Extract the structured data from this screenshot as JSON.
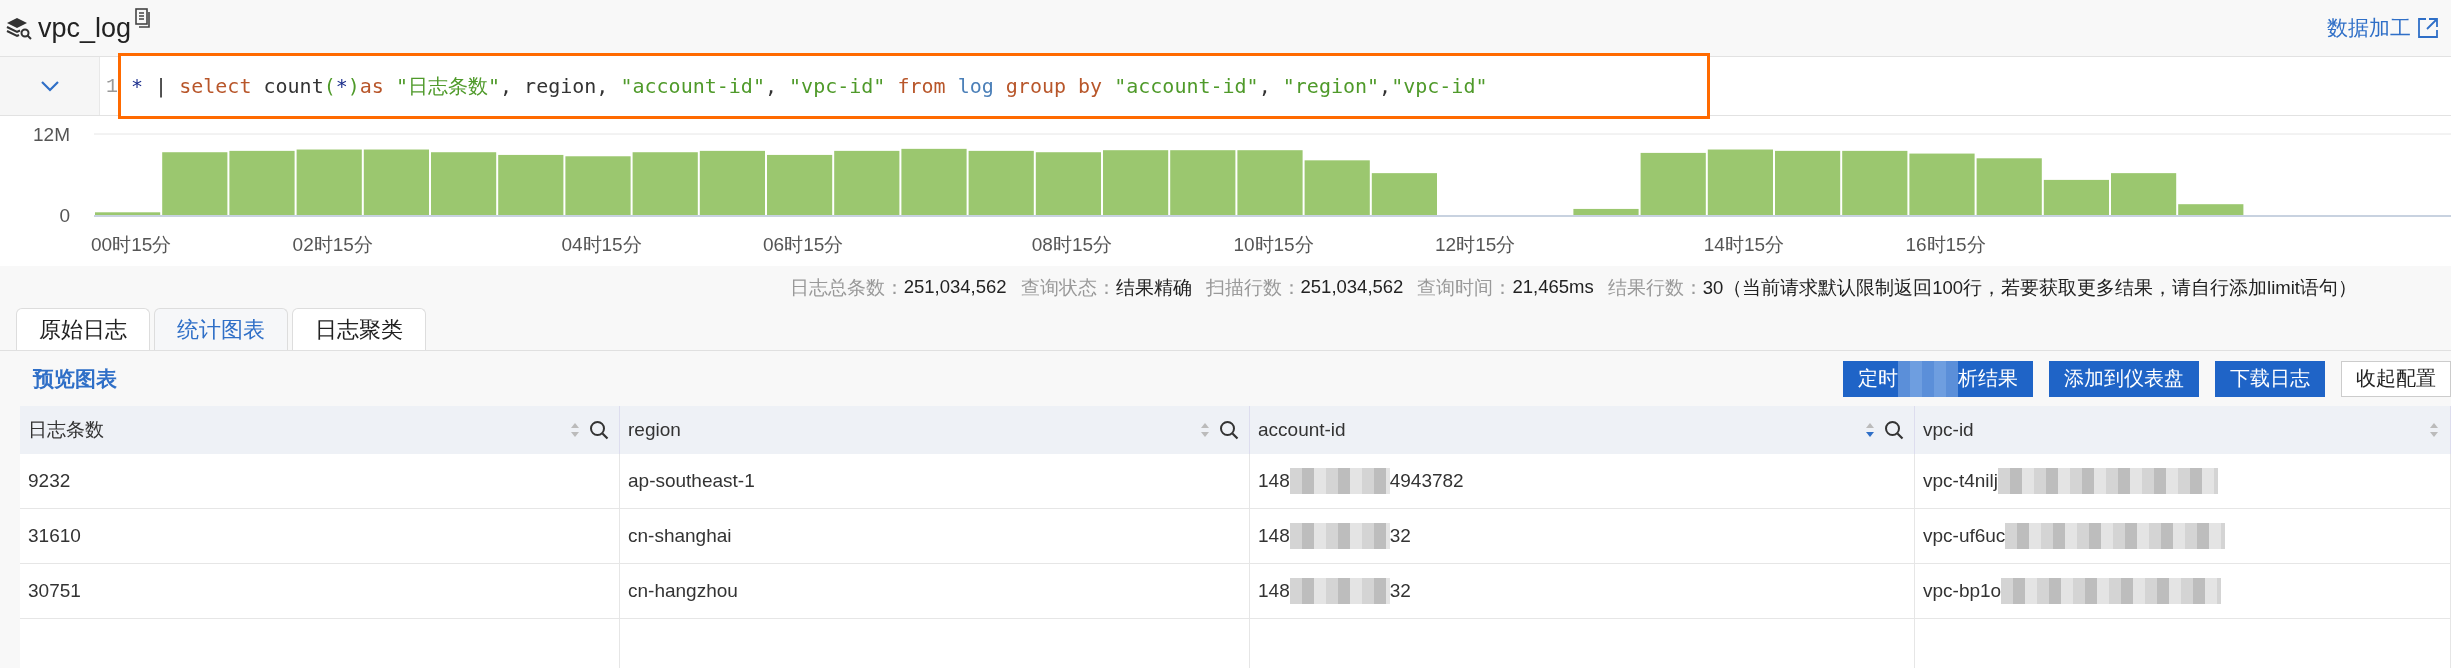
{
  "title": "vpc_log",
  "header_link": "数据加工",
  "query": {
    "line_number": "1",
    "tokens": [
      {
        "text": "*",
        "kind": "operator"
      },
      {
        "text": " | ",
        "kind": "plain"
      },
      {
        "text": "select",
        "kind": "keyword"
      },
      {
        "text": " count",
        "kind": "plain"
      },
      {
        "text": "(",
        "kind": "string"
      },
      {
        "text": "*",
        "kind": "operator"
      },
      {
        "text": ")",
        "kind": "string"
      },
      {
        "text": "as ",
        "kind": "keyword"
      },
      {
        "text": "\"日志条数\"",
        "kind": "string"
      },
      {
        "text": ", region, ",
        "kind": "plain"
      },
      {
        "text": "\"account-id\"",
        "kind": "string"
      },
      {
        "text": ", ",
        "kind": "plain"
      },
      {
        "text": "\"vpc-id\"",
        "kind": "string"
      },
      {
        "text": " from ",
        "kind": "keyword"
      },
      {
        "text": "log ",
        "kind": "ident"
      },
      {
        "text": "group by ",
        "kind": "keyword"
      },
      {
        "text": "\"account-id\"",
        "kind": "string"
      },
      {
        "text": ", ",
        "kind": "plain"
      },
      {
        "text": "\"region\"",
        "kind": "string"
      },
      {
        "text": ",",
        "kind": "plain"
      },
      {
        "text": "\"vpc-id\"",
        "kind": "string"
      }
    ]
  },
  "histogram": {
    "chart_data": {
      "type": "bar",
      "ylim": [
        0,
        12
      ],
      "yticks": [
        {
          "value": 0,
          "label": "0"
        },
        {
          "value": 12,
          "label": "12M"
        }
      ],
      "categories": [
        "00时15分",
        null,
        null,
        "02时15分",
        null,
        null,
        null,
        "04时15分",
        null,
        null,
        "06时15分",
        null,
        null,
        null,
        "08时15分",
        null,
        null,
        "10时15分",
        null,
        null,
        "12时15分",
        null,
        null,
        null,
        "14时15分",
        null,
        null,
        "16时15分",
        null,
        null,
        null,
        null,
        null,
        null,
        null
      ],
      "series": [
        {
          "color": "#9bc76f",
          "values": [
            0.4,
            9.3,
            9.5,
            9.7,
            9.7,
            9.3,
            8.9,
            8.7,
            9.3,
            9.5,
            8.9,
            9.5,
            9.8,
            9.5,
            9.3,
            9.6,
            9.6,
            9.6,
            8.1,
            6.2,
            null,
            null,
            0.9,
            9.2,
            9.7,
            9.5,
            9.5,
            9.1,
            8.4,
            5.2,
            6.2,
            1.6,
            null,
            null,
            null
          ]
        }
      ]
    }
  },
  "stats": [
    {
      "label": "日志总条数：",
      "value": "251,034,562"
    },
    {
      "label": "查询状态：",
      "value": "结果精确"
    },
    {
      "label": "扫描行数：",
      "value": "251,034,562"
    },
    {
      "label": "查询时间：",
      "value": "21,465ms"
    },
    {
      "label": "结果行数：",
      "value": "30（当前请求默认限制返回100行，若要获取更多结果，请自行添加limit语句）"
    }
  ],
  "tabs": [
    {
      "label": "原始日志",
      "selected": false
    },
    {
      "label": "统计图表",
      "selected": true
    },
    {
      "label": "日志聚类",
      "selected": false
    }
  ],
  "panel": {
    "title": "预览图表",
    "buttons": [
      {
        "parts": [
          "定时",
          "析结果"
        ],
        "kind": "primary"
      },
      {
        "parts": [
          "添加到仪表盘"
        ],
        "kind": "primary"
      },
      {
        "parts": [
          "下载日志"
        ],
        "kind": "primary"
      },
      {
        "parts": [
          "收起配置"
        ],
        "kind": "default"
      }
    ]
  },
  "table": {
    "columns": [
      {
        "title": "日志条数",
        "sorted_desc": false,
        "searchable": true
      },
      {
        "title": "region",
        "sorted_desc": false,
        "searchable": true
      },
      {
        "title": "account-id",
        "sorted_desc": true,
        "searchable": true
      },
      {
        "title": "vpc-id",
        "sorted_desc": false,
        "searchable": false
      }
    ],
    "rows": [
      [
        {
          "parts": [
            "9232"
          ],
          "masked_end": false
        },
        {
          "parts": [
            "ap-southeast-1"
          ],
          "masked_end": false
        },
        {
          "parts": [
            "148",
            "4943782"
          ],
          "masked_end": false
        },
        {
          "parts": [
            "vpc-t4nilj"
          ],
          "masked_end": true
        }
      ],
      [
        {
          "parts": [
            "31610"
          ],
          "masked_end": false
        },
        {
          "parts": [
            "cn-shanghai"
          ],
          "masked_end": false
        },
        {
          "parts": [
            "148",
            "32"
          ],
          "masked_end": false
        },
        {
          "parts": [
            "vpc-uf6uc"
          ],
          "masked_end": true
        }
      ],
      [
        {
          "parts": [
            "30751"
          ],
          "masked_end": false
        },
        {
          "parts": [
            "cn-hangzhou"
          ],
          "masked_end": false
        },
        {
          "parts": [
            "148",
            "32"
          ],
          "masked_end": false
        },
        {
          "parts": [
            "vpc-bp1o"
          ],
          "masked_end": true
        }
      ]
    ]
  }
}
